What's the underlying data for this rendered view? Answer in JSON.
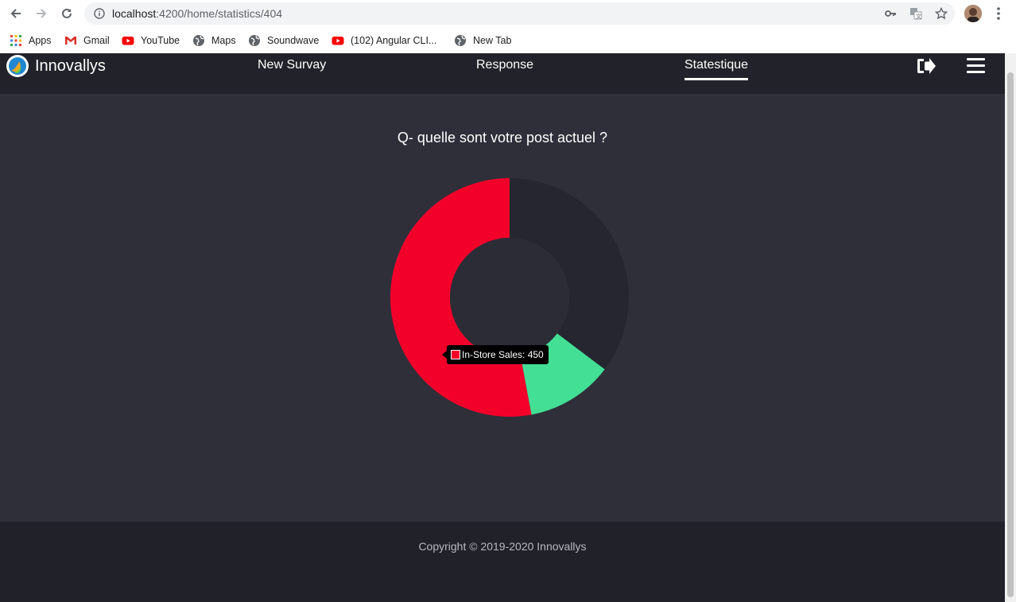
{
  "browser": {
    "url_host": "localhost",
    "url_path": ":4200/home/statistics/404",
    "bookmarks": [
      {
        "label": "Apps",
        "icon": "apps-grid-icon"
      },
      {
        "label": "Gmail",
        "icon": "gmail-icon"
      },
      {
        "label": "YouTube",
        "icon": "youtube-icon"
      },
      {
        "label": "Maps",
        "icon": "globe-icon"
      },
      {
        "label": "Soundwave",
        "icon": "globe-icon"
      },
      {
        "label": "(102) Angular CLI...",
        "icon": "youtube-icon"
      },
      {
        "label": "New Tab",
        "icon": "globe-icon"
      }
    ]
  },
  "navbar": {
    "brand": "Innovallys",
    "links": [
      "New Survay",
      "Response",
      "Statestique"
    ],
    "active_link": "Statestique"
  },
  "main": {
    "question": "Q- quelle sont votre post actuel ?"
  },
  "tooltip": {
    "text": "In-Store Sales: 450"
  },
  "chart_data": {
    "type": "doughnut",
    "series": [
      {
        "name": "In-Store Sales",
        "value": 450,
        "color": "#f2002a"
      },
      {
        "name": "",
        "value": 100,
        "color": "#42df95"
      },
      {
        "name": "",
        "value": 300,
        "color": "#262630"
      }
    ],
    "start": "top",
    "direction": "counterclockwise"
  },
  "footer": {
    "copyright": "Copyright © 2019-2020 Innovallys"
  },
  "colors": {
    "navbar": "#22222a",
    "page": "#2f2f3a",
    "footer": "#21212a"
  }
}
